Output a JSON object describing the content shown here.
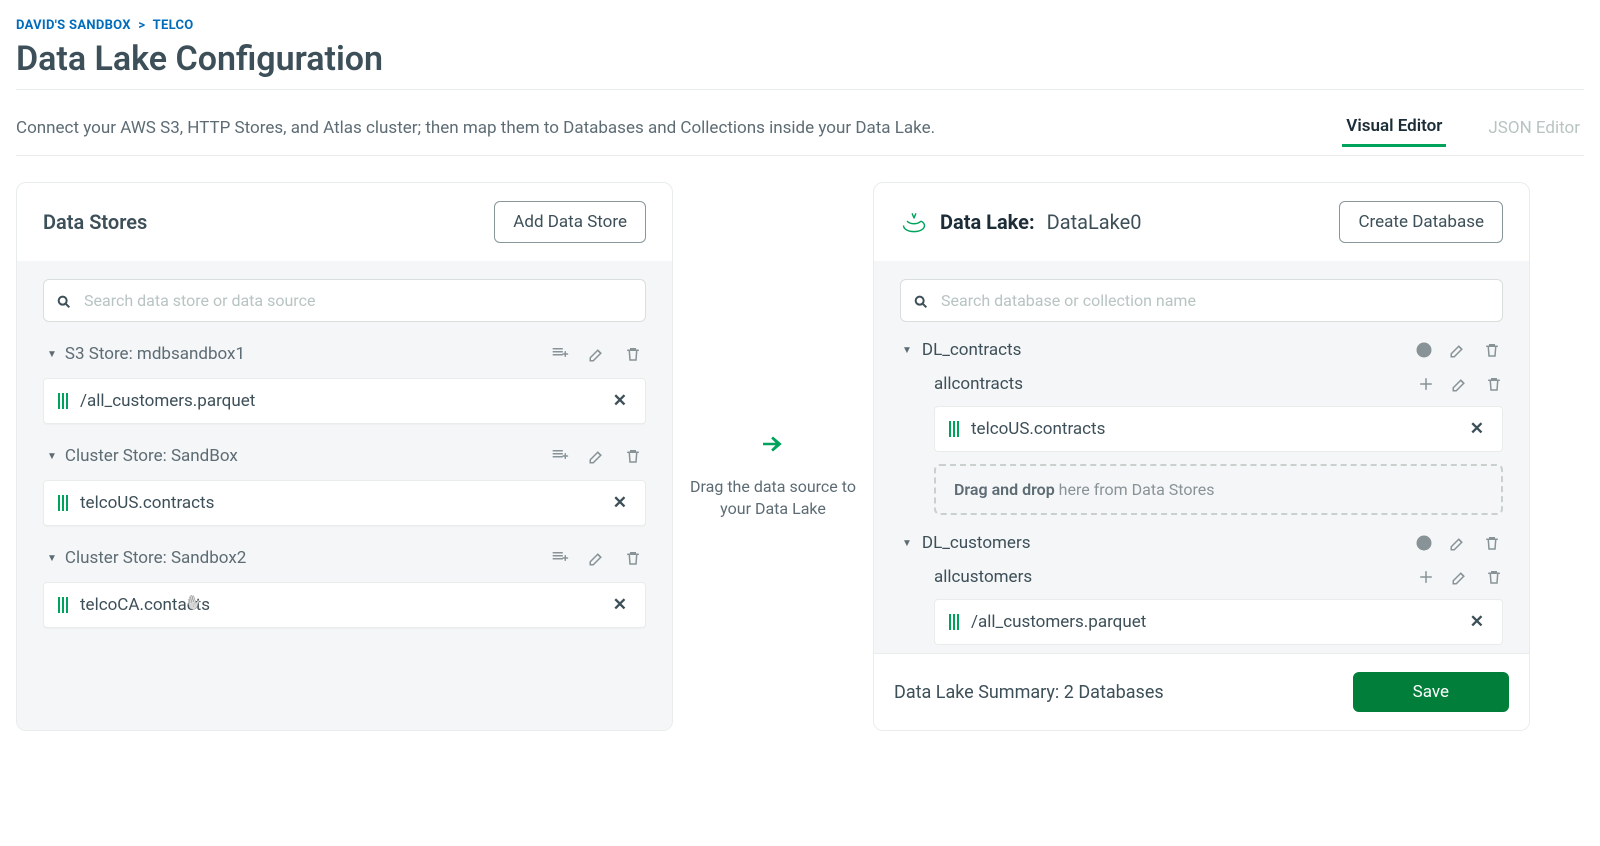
{
  "breadcrumb": {
    "a": "DAVID'S SANDBOX",
    "sep": ">",
    "b": "TELCO"
  },
  "title": "Data Lake Configuration",
  "description": "Connect your AWS S3, HTTP Stores, and Atlas cluster; then map them to Databases and Collections inside your Data Lake.",
  "tabs": {
    "visual": "Visual Editor",
    "json": "JSON Editor"
  },
  "left": {
    "heading": "Data Stores",
    "add_btn": "Add Data Store",
    "search_placeholder": "Search data store or data source",
    "stores": [
      {
        "label": "S3 Store: mdbsandbox1",
        "files": [
          "/all_customers.parquet"
        ]
      },
      {
        "label": "Cluster Store: SandBox",
        "files": [
          "telcoUS.contracts"
        ]
      },
      {
        "label": "Cluster Store: Sandbox2",
        "files": [
          "telcoCA.contacts"
        ]
      }
    ]
  },
  "middle": {
    "hint1": "Drag the data source to",
    "hint2": "your Data Lake"
  },
  "right": {
    "label": "Data Lake:",
    "name": "DataLake0",
    "create_btn": "Create Database",
    "search_placeholder": "Search database or collection name",
    "dropzone_bold": "Drag and drop",
    "dropzone_rest": " here from Data Stores",
    "databases": [
      {
        "name": "DL_contracts",
        "collections": [
          {
            "name": "allcontracts",
            "sources": [
              "telcoUS.contracts"
            ],
            "show_dropzone": true
          }
        ]
      },
      {
        "name": "DL_customers",
        "collections": [
          {
            "name": "allcustomers",
            "sources": [
              "/all_customers.parquet"
            ],
            "show_dropzone": false
          }
        ]
      }
    ],
    "summary": "Data Lake Summary: 2 Databases",
    "save": "Save"
  }
}
